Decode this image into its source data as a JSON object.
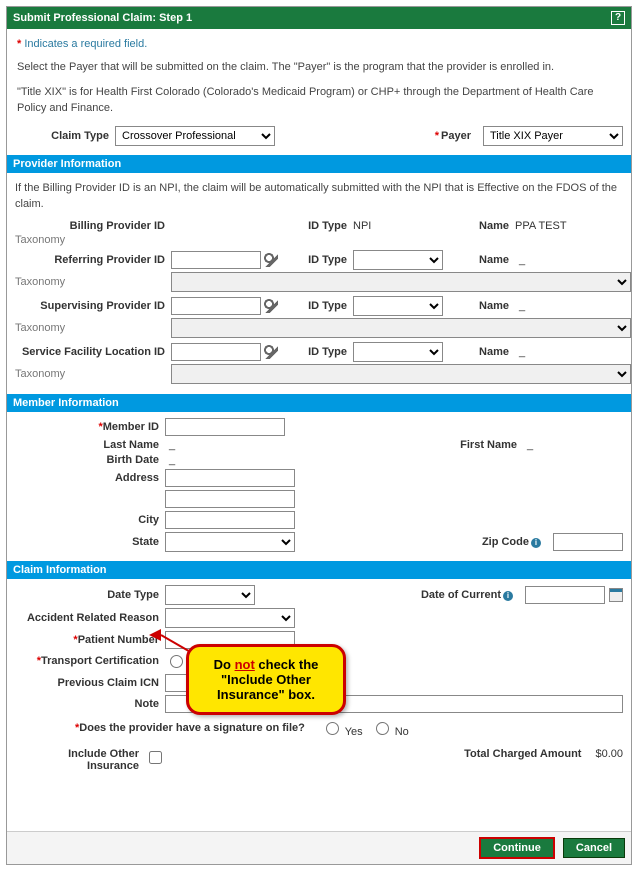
{
  "header": {
    "title": "Submit Professional Claim: Step 1",
    "help": "?"
  },
  "indicator": {
    "star": "*",
    "text": " Indicates a required field."
  },
  "intro1": "Select the Payer that will be submitted on the claim. The \"Payer\" is the program that the provider is enrolled in.",
  "intro2": "\"Title XIX\" is for Health First Colorado (Colorado's Medicaid Program) or CHP+ through the Department of Health Care Policy and Finance.",
  "topfields": {
    "claimTypeLabel": "Claim Type",
    "claimTypeValue": "Crossover Professional",
    "payerLabel": "Payer",
    "payerValue": "Title XIX Payer"
  },
  "sections": {
    "provider": "Provider Information",
    "member": "Member Information",
    "claim": "Claim Information"
  },
  "provider": {
    "note": "If the Billing Provider ID is an NPI, the claim will be automatically submitted with the NPI that is Effective on the FDOS of the claim.",
    "billingLabel": "Billing Provider ID",
    "idTypeLabel": "ID Type",
    "idTypeValue": "NPI",
    "nameLabel": "Name",
    "nameValue": "PPA TEST",
    "taxonomyLabel": "Taxonomy",
    "referringLabel": "Referring Provider ID",
    "supervisingLabel": "Supervising Provider ID",
    "facilityLabel": "Service Facility Location ID"
  },
  "member": {
    "memberIdLabel": "Member ID",
    "lastNameLabel": "Last Name",
    "firstNameLabel": "First Name",
    "birthDateLabel": "Birth Date",
    "addressLabel": "Address",
    "cityLabel": "City",
    "stateLabel": "State",
    "zipLabel": "Zip Code"
  },
  "claim": {
    "dateTypeLabel": "Date Type",
    "dateOfCurrentLabel": "Date of Current",
    "accidentLabel": "Accident Related Reason",
    "patientNumberLabel": "Patient Number",
    "transportLabel": "Transport Certification",
    "prevIcnLabel": "Previous Claim ICN",
    "noteLabel": "Note",
    "signatureLabel": "Does the provider have a signature on file?",
    "yes": "Yes",
    "no": "No",
    "includeOtherLabel": "Include Other Insurance",
    "totalChargedLabel": "Total Charged Amount",
    "totalChargedValue": "$0.00"
  },
  "buttons": {
    "continue": "Continue",
    "cancel": "Cancel"
  },
  "callout": {
    "pre": "Do ",
    "not": "not",
    "post": " check the \"Include Other Insurance\" box."
  }
}
